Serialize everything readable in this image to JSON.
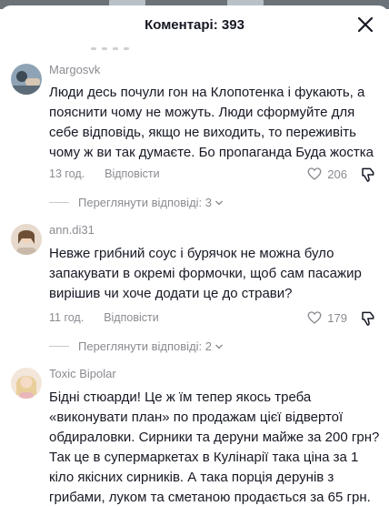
{
  "header": {
    "title": "Коментарі: 393"
  },
  "comments": [
    {
      "username": "Margosvk",
      "text": "Люди десь почули гон на Клопотенка і фукають, а пояснити чому не можуть. Люди сформуйте для себе відповідь, якщо не виходить, то переживіть чому ж ви так думаєте. Бо пропаганда Буда жостка",
      "time": "13 год.",
      "reply_label": "Відповісти",
      "likes": "206",
      "view_replies": "Переглянути відповіді: 3"
    },
    {
      "username": "ann.di31",
      "text": "Невже грибний соус і бурячок не можна було запакувати в окремі формочки, щоб сам пасажир вирішив чи хоче додати це до страви?",
      "time": "11 год.",
      "reply_label": "Відповісти",
      "likes": "179",
      "view_replies": "Переглянути відповіді: 2"
    },
    {
      "username": "Toxic Bipolar",
      "text": "Бідні стюарди! Це ж їм тепер якось треба «виконувати план» по продажам цієї відвертої обдираловки. Сирники та деруни майже за 200 грн? Так це в супермаркетах в Кулінарії така ціна за 1 кіло якісних сирників. А така порція дерунів з грибами, луком та сметаною продається за 65 грн."
    }
  ],
  "icons": {
    "close": "close-icon",
    "like": "heart-icon",
    "dislike": "thumbs-down-icon",
    "chevron": "chevron-down-icon"
  }
}
